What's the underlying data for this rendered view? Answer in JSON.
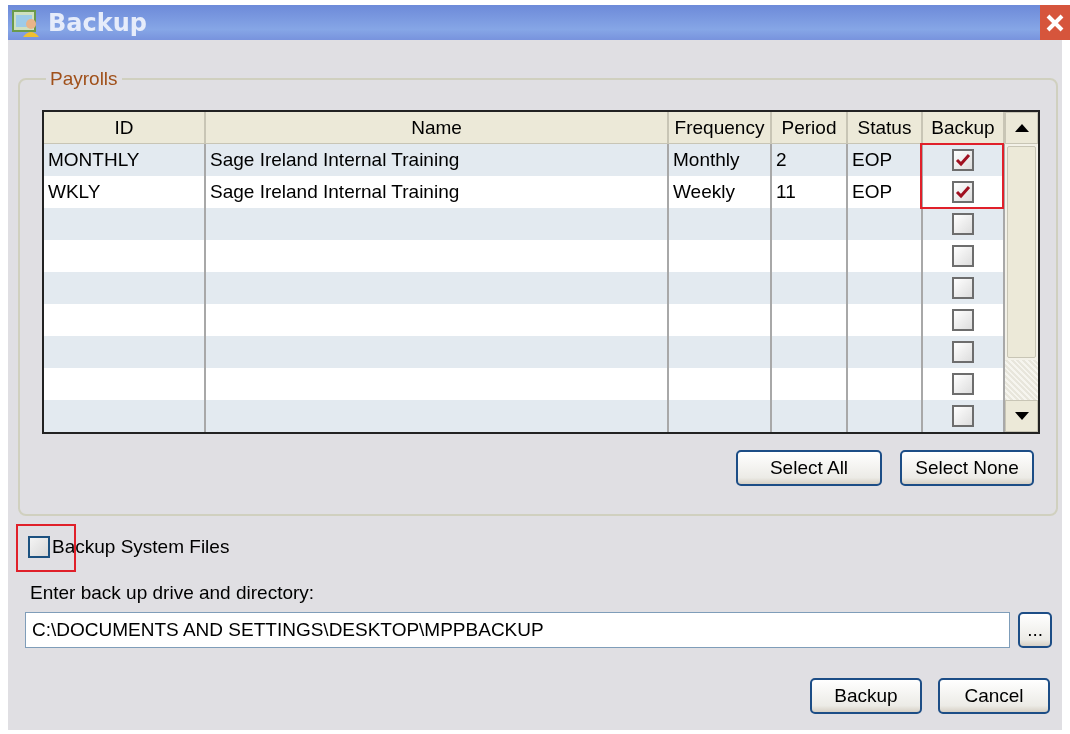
{
  "window": {
    "title": "Backup"
  },
  "payrolls": {
    "legend": "Payrolls",
    "columns": [
      "ID",
      "Name",
      "Frequency",
      "Period",
      "Status",
      "Backup"
    ],
    "rows": [
      {
        "cells": [
          "MONTHLY",
          "Sage Ireland Internal Training",
          "Monthly",
          "2",
          "EOP"
        ],
        "backup": true,
        "highlighted": true
      },
      {
        "cells": [
          "WKLY",
          "Sage Ireland Internal Training",
          "Weekly",
          "11",
          "EOP"
        ],
        "backup": true,
        "highlighted": true
      },
      {
        "cells": [],
        "backup": false,
        "highlighted": false
      },
      {
        "cells": [],
        "backup": false,
        "highlighted": false
      },
      {
        "cells": [],
        "backup": false,
        "highlighted": false
      },
      {
        "cells": [],
        "backup": false,
        "highlighted": false
      },
      {
        "cells": [],
        "backup": false,
        "highlighted": false
      },
      {
        "cells": [],
        "backup": false,
        "highlighted": false
      },
      {
        "cells": [],
        "backup": false,
        "highlighted": false
      }
    ],
    "buttons": [
      "Select All",
      "Select None"
    ]
  },
  "system_files": {
    "label": "Backup System Files",
    "checked": false,
    "highlighted": true
  },
  "directory": {
    "label": "Enter back up drive and directory:",
    "value": "C:\\DOCUMENTS AND SETTINGS\\DESKTOP\\MPPBACKUP",
    "browse": "..."
  },
  "buttons": [
    "Backup",
    "Cancel"
  ]
}
